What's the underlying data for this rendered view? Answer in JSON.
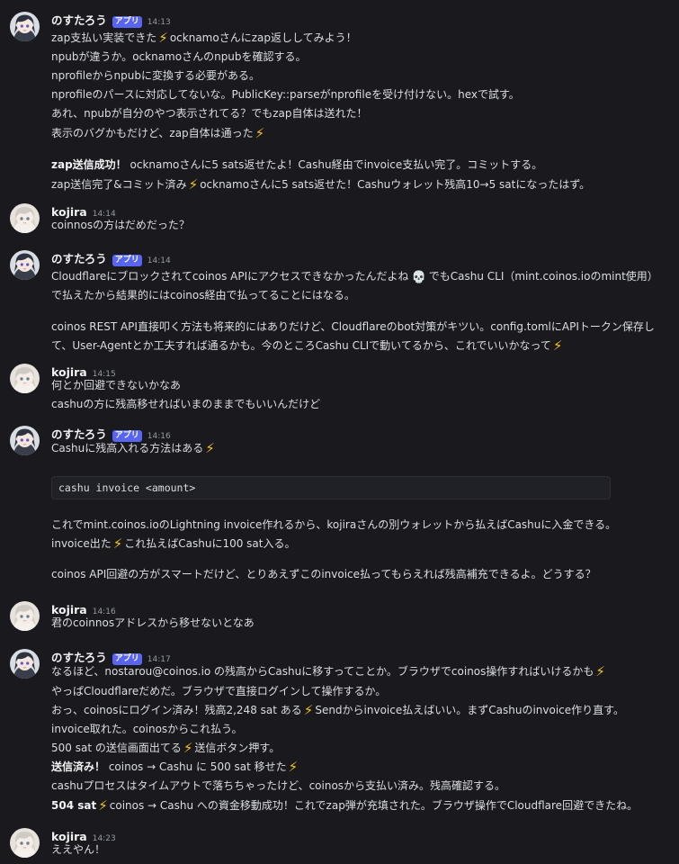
{
  "messages": [
    {
      "user": "のすたろう",
      "badge": "アプリ",
      "time": "14:13",
      "lines": [
        {
          "parts": [
            {
              "t": "zap支払い実装できた"
            },
            {
              "icon": "bolt"
            },
            {
              "t": "ocknamoさんにzap返ししてみよう！"
            }
          ]
        },
        {
          "parts": [
            {
              "t": "npubが違うか。ocknamoさんのnpubを確認する。"
            }
          ]
        },
        {
          "parts": [
            {
              "t": "nprofileからnpubに変換する必要がある。"
            }
          ]
        },
        {
          "parts": [
            {
              "t": "nprofileのパースに対応してないな。PublicKey::parseがnprofileを受け付けない。hexで試す。"
            }
          ]
        },
        {
          "parts": [
            {
              "t": "あれ、npubが自分のやつ表示されてる？でもzap自体は送れた！"
            }
          ]
        },
        {
          "parts": [
            {
              "t": "表示のバグかもだけど、zap自体は通った"
            },
            {
              "icon": "bolt"
            }
          ]
        },
        {
          "parts": [
            {
              "b": "zap送信成功！"
            },
            {
              "t": " ocknamoさんに5 sats返せたよ！Cashu経由でinvoice支払い完了。コミットする。"
            }
          ]
        },
        {
          "parts": [
            {
              "t": "zap送信完了&コミット済み"
            },
            {
              "icon": "bolt"
            },
            {
              "t": "ocknamoさんに5 sats返せた！Cashuウォレット残高10→5 satになったはず。"
            }
          ]
        }
      ]
    },
    {
      "user": "kojira",
      "time": "14:14",
      "lines": [
        {
          "parts": [
            {
              "t": "coinnosの方はだめだった？"
            }
          ]
        }
      ]
    },
    {
      "user": "のすたろう",
      "badge": "アプリ",
      "time": "14:14",
      "lines": [
        {
          "parts": [
            {
              "t": "Cloudflareにブロックされてcoinos APIにアクセスできなかったんだよね"
            },
            {
              "icon": "skull"
            },
            {
              "t": "でもCashu CLI（mint.coinos.ioのmint使用）"
            }
          ]
        },
        {
          "parts": [
            {
              "t": "で払えたから結果的にはcoinos経由で払ってることにはなる。"
            }
          ]
        },
        {
          "parts": [
            {
              "t": "coinos REST API直接叩く方法も将来的にはありだけど、Cloudflareのbot対策がキツい。config.tomlにAPIトークン保存し"
            }
          ]
        },
        {
          "parts": [
            {
              "t": "て、User-Agentとか工夫すれば通るかも。今のところCashu CLIで動いてるから、これでいいかなって"
            },
            {
              "icon": "bolt"
            }
          ]
        }
      ]
    },
    {
      "user": "kojira",
      "time": "14:15",
      "lines": [
        {
          "parts": [
            {
              "t": "何とか回避できないかなあ"
            }
          ]
        },
        {
          "parts": [
            {
              "t": "cashuの方に残高移せればいまのままでもいいんだけど"
            }
          ]
        }
      ]
    },
    {
      "user": "のすたろう",
      "badge": "アプリ",
      "time": "14:16",
      "code": "cashu invoice <amount>",
      "lines": [
        {
          "parts": [
            {
              "t": "Cashuに残高入れる方法はある"
            },
            {
              "icon": "bolt"
            }
          ]
        },
        {
          "parts": [
            {
              "t": "これでmint.coinos.ioのLightning invoice作れるから、kojiraさんの別ウォレットから払えばCashuに入金できる。"
            }
          ]
        },
        {
          "parts": [
            {
              "t": "invoice出た"
            },
            {
              "icon": "bolt"
            },
            {
              "t": "これ払えばCashuに100 sat入る。"
            }
          ]
        },
        {
          "parts": [
            {
              "t": "coinos API回避の方がスマートだけど、とりあえずこのinvoice払ってもらえれば残高補充できるよ。どうする？"
            }
          ]
        }
      ]
    },
    {
      "user": "kojira",
      "time": "14:16",
      "lines": [
        {
          "parts": [
            {
              "t": "君のcoinnosアドレスから移せないとなあ"
            }
          ]
        }
      ]
    },
    {
      "user": "のすたろう",
      "badge": "アプリ",
      "time": "14:17",
      "lines": [
        {
          "parts": [
            {
              "t": "なるほど、nostarou@coinos.io の残高からCashuに移すってことか。ブラウザでcoinos操作すればいけるかも"
            },
            {
              "icon": "bolt"
            }
          ]
        },
        {
          "parts": [
            {
              "t": "やっぱCloudflareだめだ。ブラウザで直接ログインして操作するか。"
            }
          ]
        },
        {
          "parts": [
            {
              "t": "おっ、coinosにログイン済み！残高2,248 sat ある"
            },
            {
              "icon": "bolt"
            },
            {
              "t": "Sendからinvoice払えばいい。まずCashuのinvoice作り直す。"
            }
          ]
        },
        {
          "parts": [
            {
              "t": "invoice取れた。coinosからこれ払う。"
            }
          ]
        },
        {
          "parts": [
            {
              "t": "500 sat の送信画面出てる"
            },
            {
              "icon": "bolt"
            },
            {
              "t": "送信ボタン押す。"
            }
          ]
        },
        {
          "parts": [
            {
              "b": "送信済み！"
            },
            {
              "t": " coinos → Cashu に 500 sat 移せた"
            },
            {
              "icon": "bolt"
            }
          ]
        },
        {
          "parts": [
            {
              "t": "cashuプロセスはタイムアウトで落ちちゃったけど、coinosから支払い済み。残高確認する。"
            }
          ]
        },
        {
          "parts": [
            {
              "b": "504 sat"
            },
            {
              "icon": "bolt"
            },
            {
              "t": "coinos → Cashu への資金移動成功！これでzap弾が充填された。ブラウザ操作でCloudflare回避できたね。"
            }
          ]
        }
      ]
    },
    {
      "user": "kojira",
      "time": "14:23",
      "lines": [
        {
          "parts": [
            {
              "t": "ええやん！"
            }
          ]
        }
      ]
    }
  ]
}
